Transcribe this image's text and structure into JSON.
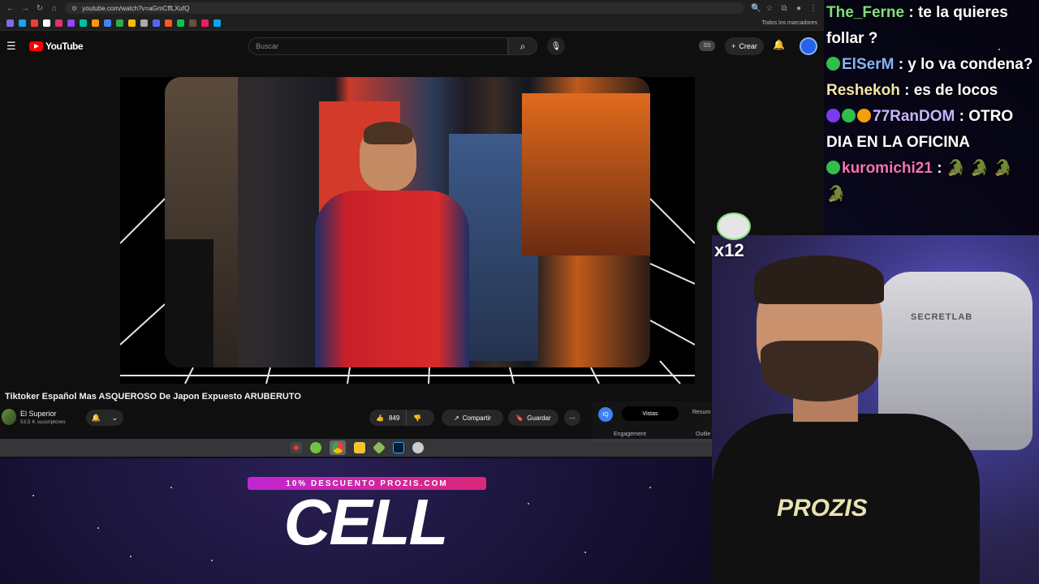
{
  "browser": {
    "url": "youtube.com/watch?v=aGmCffLXufQ",
    "bookmarks_all_label": "Todos los marcadores"
  },
  "youtube": {
    "logo_text": "YouTube",
    "search_placeholder": "Buscar",
    "profile_badge": "SS",
    "create_label": "Crear"
  },
  "video": {
    "title": "Tiktoker Español Mas ASQUEROSO De Japon Expuesto ARUBERUTO",
    "channel_name": "El Superior",
    "channel_subscribers": "53,5 K suscriptores",
    "like_count": "849",
    "share_label": "Compartir",
    "save_label": "Guardar"
  },
  "side_panel": {
    "logo": "IQ",
    "tab_active": "Vistas",
    "tab_next": "Resum",
    "row_left": "Engagement",
    "row_right": "Outlie"
  },
  "promo": {
    "strip": "10% DESCUENTO PROZIS.COM",
    "word": "CELL"
  },
  "chat": [
    {
      "user": "The_Ferne",
      "text": " : te la quieres follar ?",
      "color": "#7fe07a",
      "badges": []
    },
    {
      "user": "ElSerM",
      "text": " : y lo va condena?",
      "color": "#8ab4f8",
      "badges": [
        "#2fbf4a"
      ]
    },
    {
      "user": "Reshekoh",
      "text": " : es de locos",
      "color": "#f2e6a6",
      "badges": []
    },
    {
      "user": "77RanDOM",
      "text": " : OTRO DIA EN LA OFICINA",
      "color": "#c9b4ff",
      "badges": [
        "#7c3aed",
        "#2fbf4a",
        "#f59e0b"
      ]
    },
    {
      "user": "kuromichi21",
      "text": " : 🐊 🐊 🐊 🐊",
      "color": "#f472b6",
      "badges": [
        "#2fbf4a"
      ]
    }
  ],
  "overlay": {
    "gift_count": "x12",
    "shirt_text": "PROZIS",
    "chair_brand": "SECRETLAB"
  }
}
